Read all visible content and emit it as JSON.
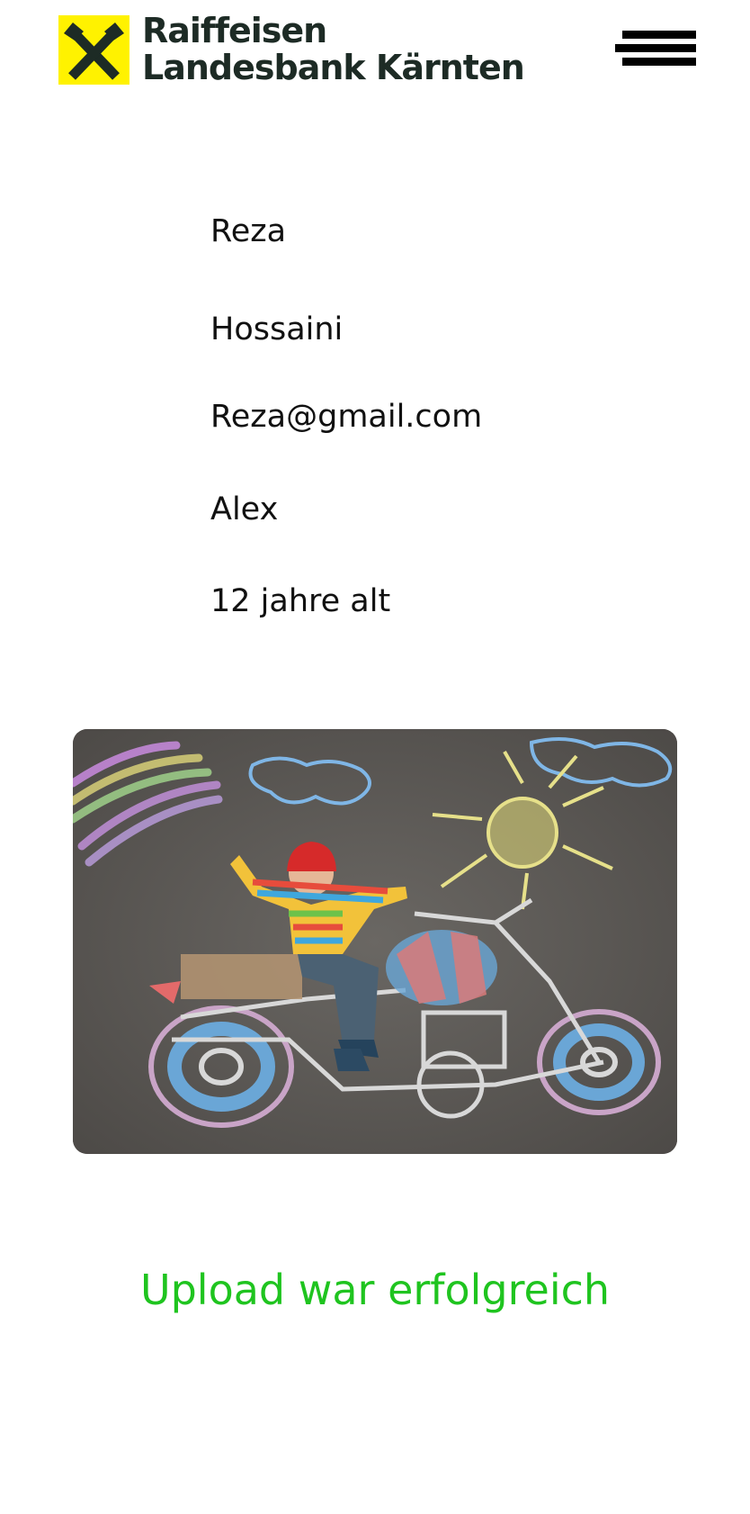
{
  "header": {
    "logo": {
      "line1": "Raiffeisen",
      "line2": "Landesbank Kärnten",
      "icon": "raiffeisen-gable-cross-icon",
      "brand_yellow": "#fff200",
      "brand_dark": "#1d2b25"
    },
    "menu_icon": "hamburger-menu-icon"
  },
  "profile": {
    "first_name": "Reza",
    "last_name": "Hossaini",
    "email": "Reza@gmail.com",
    "child_name": "Alex",
    "child_age": "12 jahre alt"
  },
  "upload": {
    "image_subject": "child-chalk-motorcycle-drawing",
    "status_text": "Upload war erfolgreich",
    "status_color": "#1fc41f"
  }
}
